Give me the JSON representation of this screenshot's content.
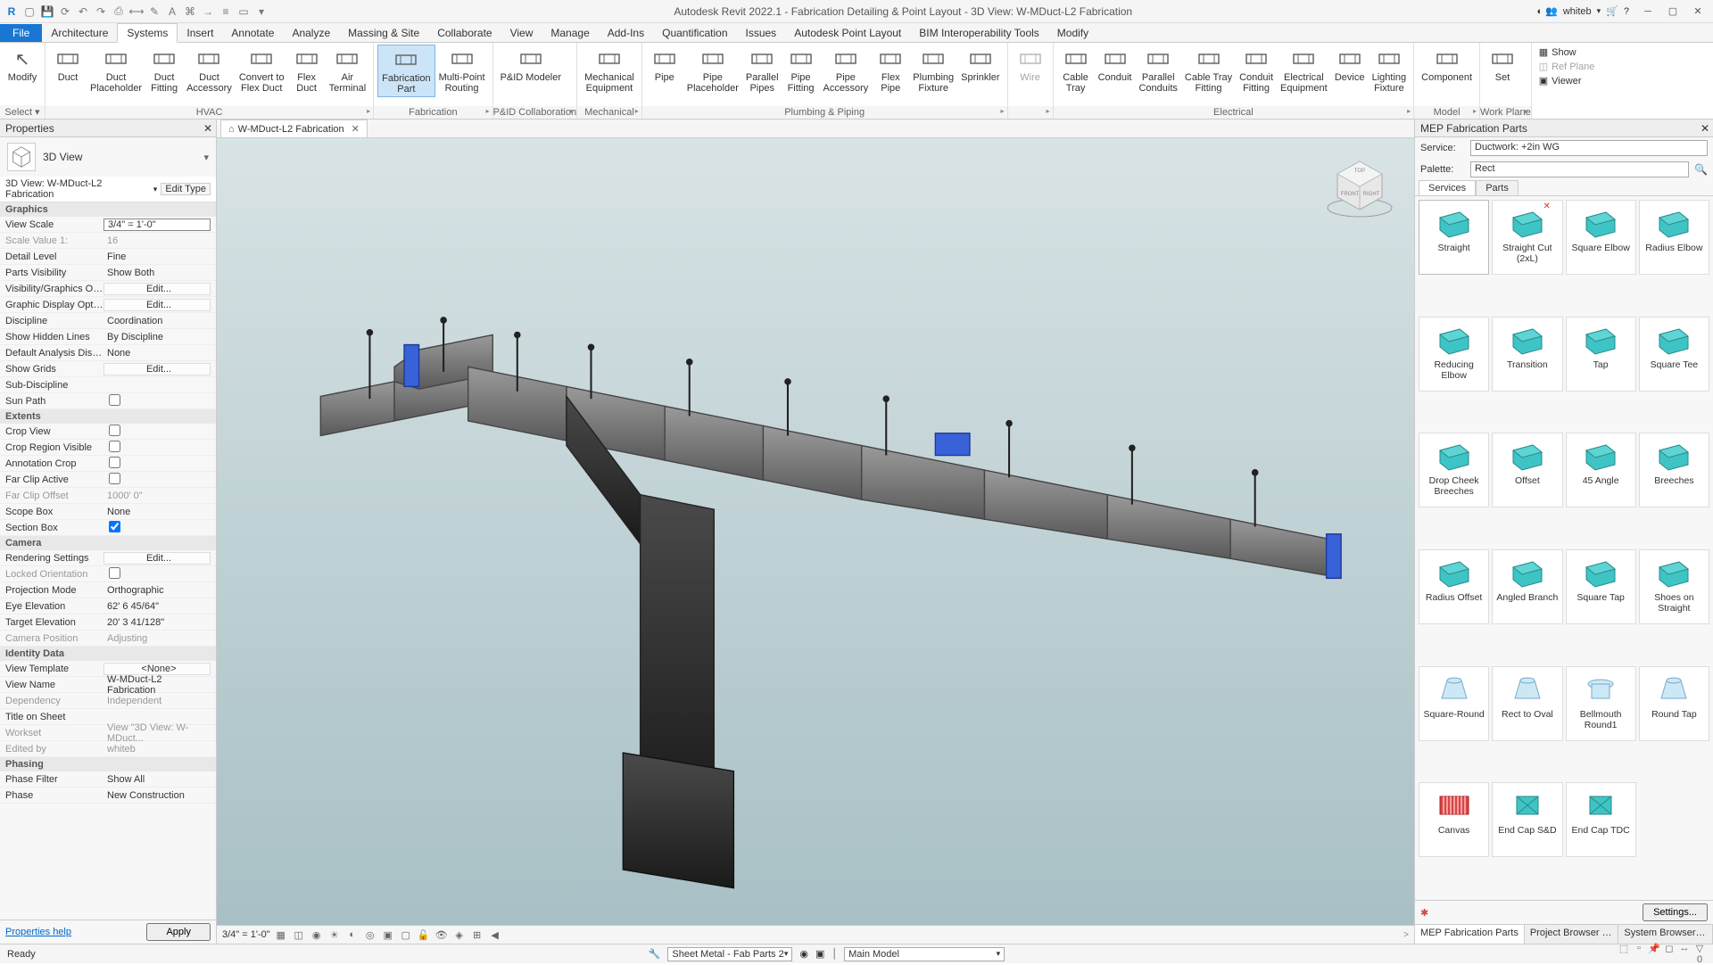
{
  "title": "Autodesk Revit 2022.1 - Fabrication Detailing & Point Layout - 3D View: W-MDuct-L2 Fabrication",
  "user": "whiteb",
  "menu_tabs": [
    "File",
    "Architecture",
    "Systems",
    "Insert",
    "Annotate",
    "Analyze",
    "Massing & Site",
    "Collaborate",
    "View",
    "Manage",
    "Add-Ins",
    "Quantification",
    "Issues",
    "Autodesk Point Layout",
    "BIM Interoperability Tools",
    "Modify"
  ],
  "active_menu": "Systems",
  "ribbon": {
    "select": "Select ▾",
    "groups": [
      {
        "label": "HVAC",
        "buttons": [
          {
            "label": "Duct",
            "icon": "duct"
          },
          {
            "label": "Duct\nPlaceholder",
            "icon": "duct-ph"
          },
          {
            "label": "Duct\nFitting",
            "icon": "duct-fit"
          },
          {
            "label": "Duct\nAccessory",
            "icon": "duct-acc"
          },
          {
            "label": "Convert to\nFlex Duct",
            "icon": "flex"
          },
          {
            "label": "Flex\nDuct",
            "icon": "flex-duct"
          },
          {
            "label": "Air\nTerminal",
            "icon": "air"
          }
        ]
      },
      {
        "label": "Fabrication",
        "buttons": [
          {
            "label": "Fabrication\nPart",
            "icon": "fab",
            "active": true
          },
          {
            "label": "Multi-Point\nRouting",
            "icon": "route"
          }
        ]
      },
      {
        "label": "P&ID Collaboration",
        "buttons": [
          {
            "label": "P&ID Modeler",
            "icon": "pid"
          }
        ]
      },
      {
        "label": "Mechanical",
        "buttons": [
          {
            "label": "Mechanical\nEquipment",
            "icon": "mech"
          }
        ]
      },
      {
        "label": "Plumbing & Piping",
        "buttons": [
          {
            "label": "Pipe",
            "icon": "pipe"
          },
          {
            "label": "Pipe\nPlaceholder",
            "icon": "pipe-ph"
          },
          {
            "label": "Parallel\nPipes",
            "icon": "parallel"
          },
          {
            "label": "Pipe\nFitting",
            "icon": "pipe-fit"
          },
          {
            "label": "Pipe\nAccessory",
            "icon": "pipe-acc"
          },
          {
            "label": "Flex\nPipe",
            "icon": "flex-pipe"
          },
          {
            "label": "Plumbing\nFixture",
            "icon": "plumb"
          },
          {
            "label": "Sprinkler",
            "icon": "sprinkler"
          }
        ]
      },
      {
        "label": "",
        "buttons": [
          {
            "label": "Wire",
            "icon": "wire",
            "disabled": true
          }
        ]
      },
      {
        "label": "Electrical",
        "buttons": [
          {
            "label": "Cable\nTray",
            "icon": "ctray"
          },
          {
            "label": "Conduit",
            "icon": "conduit"
          },
          {
            "label": "Parallel\nConduits",
            "icon": "pconduit"
          },
          {
            "label": "Cable Tray\nFitting",
            "icon": "ctfit"
          },
          {
            "label": "Conduit\nFitting",
            "icon": "cfit"
          },
          {
            "label": "Electrical\nEquipment",
            "icon": "eequip"
          },
          {
            "label": "Device",
            "icon": "device"
          },
          {
            "label": "Lighting\nFixture",
            "icon": "light"
          }
        ]
      },
      {
        "label": "Model",
        "buttons": [
          {
            "label": "Component",
            "icon": "comp"
          }
        ]
      },
      {
        "label": "Work Plane",
        "buttons": [
          {
            "label": "Set",
            "icon": "set"
          }
        ]
      }
    ],
    "workplane_items": [
      "Show",
      "Ref Plane",
      "Viewer"
    ]
  },
  "properties": {
    "title": "Properties",
    "type_name": "3D View",
    "instance_name": "3D View: W-MDuct-L2 Fabrication",
    "edit_type": "Edit Type",
    "sections": [
      {
        "name": "Graphics",
        "rows": [
          {
            "l": "View Scale",
            "v": "3/4\" = 1'-0\"",
            "boxed": true
          },
          {
            "l": "Scale Value    1:",
            "v": "16",
            "dim": true
          },
          {
            "l": "Detail Level",
            "v": "Fine"
          },
          {
            "l": "Parts Visibility",
            "v": "Show Both"
          },
          {
            "l": "Visibility/Graphics Overri...",
            "v": "Edit...",
            "btn": true
          },
          {
            "l": "Graphic Display Options",
            "v": "Edit...",
            "btn": true
          },
          {
            "l": "Discipline",
            "v": "Coordination"
          },
          {
            "l": "Show Hidden Lines",
            "v": "By Discipline"
          },
          {
            "l": "Default Analysis Display ...",
            "v": "None"
          },
          {
            "l": "Show Grids",
            "v": "Edit...",
            "btn": true
          },
          {
            "l": "Sub-Discipline",
            "v": ""
          },
          {
            "l": "Sun Path",
            "v": "",
            "check": false
          }
        ]
      },
      {
        "name": "Extents",
        "rows": [
          {
            "l": "Crop View",
            "v": "",
            "check": false
          },
          {
            "l": "Crop Region Visible",
            "v": "",
            "check": false
          },
          {
            "l": "Annotation Crop",
            "v": "",
            "check": false
          },
          {
            "l": "Far Clip Active",
            "v": "",
            "check": false
          },
          {
            "l": "Far Clip Offset",
            "v": "1000'  0\"",
            "dim": true
          },
          {
            "l": "Scope Box",
            "v": "None"
          },
          {
            "l": "Section Box",
            "v": "",
            "check": true
          }
        ]
      },
      {
        "name": "Camera",
        "rows": [
          {
            "l": "Rendering Settings",
            "v": "Edit...",
            "btn": true
          },
          {
            "l": "Locked Orientation",
            "v": "",
            "check": false,
            "dim": true
          },
          {
            "l": "Projection Mode",
            "v": "Orthographic"
          },
          {
            "l": "Eye Elevation",
            "v": "62'  6 45/64\""
          },
          {
            "l": "Target Elevation",
            "v": "20'  3 41/128\""
          },
          {
            "l": "Camera Position",
            "v": "Adjusting",
            "dim": true
          }
        ]
      },
      {
        "name": "Identity Data",
        "rows": [
          {
            "l": "View Template",
            "v": "<None>",
            "btn": true
          },
          {
            "l": "View Name",
            "v": "W-MDuct-L2 Fabrication"
          },
          {
            "l": "Dependency",
            "v": "Independent",
            "dim": true
          },
          {
            "l": "Title on Sheet",
            "v": ""
          },
          {
            "l": "Workset",
            "v": "View \"3D View: W-MDuct...",
            "dim": true
          },
          {
            "l": "Edited by",
            "v": "whiteb",
            "dim": true
          }
        ]
      },
      {
        "name": "Phasing",
        "rows": [
          {
            "l": "Phase Filter",
            "v": "Show All"
          },
          {
            "l": "Phase",
            "v": "New Construction"
          }
        ]
      }
    ],
    "help_link": "Properties help",
    "apply": "Apply"
  },
  "view_tab": "W-MDuct-L2 Fabrication",
  "canvas_scale": "3/4\" = 1'-0\"",
  "mep": {
    "title": "MEP Fabrication Parts",
    "service_label": "Service:",
    "service_value": "Ductwork: +2in WG",
    "palette_label": "Palette:",
    "palette_value": "Rect",
    "tabs": [
      "Services",
      "Parts"
    ],
    "active_tab": "Services",
    "items": [
      {
        "label": "Straight",
        "icon": "straight"
      },
      {
        "label": "Straight Cut (2xL)",
        "icon": "straightcut",
        "x": true
      },
      {
        "label": "Square Elbow",
        "icon": "sqelbow"
      },
      {
        "label": "Radius Elbow",
        "icon": "radelbow"
      },
      {
        "label": "Reducing Elbow",
        "icon": "redelbow"
      },
      {
        "label": "Transition",
        "icon": "transition"
      },
      {
        "label": "Tap",
        "icon": "tap"
      },
      {
        "label": "Square Tee",
        "icon": "sqtee"
      },
      {
        "label": "Drop Cheek Breeches",
        "icon": "dropcheek"
      },
      {
        "label": "Offset",
        "icon": "offset"
      },
      {
        "label": "45 Angle",
        "icon": "angle45"
      },
      {
        "label": "Breeches",
        "icon": "breeches"
      },
      {
        "label": "Radius Offset",
        "icon": "radoffset"
      },
      {
        "label": "Angled Branch",
        "icon": "angbranch"
      },
      {
        "label": "Square Tap",
        "icon": "sqtap"
      },
      {
        "label": "Shoes on Straight",
        "icon": "shoes"
      },
      {
        "label": "Square-Round",
        "icon": "sqround"
      },
      {
        "label": "Rect to Oval",
        "icon": "rectoval"
      },
      {
        "label": "Bellmouth Round1",
        "icon": "bellmouth"
      },
      {
        "label": "Round Tap",
        "icon": "roundtap"
      },
      {
        "label": "Canvas",
        "icon": "canvas"
      },
      {
        "label": "End Cap S&D",
        "icon": "endcap1"
      },
      {
        "label": "End Cap TDC",
        "icon": "endcap2"
      }
    ],
    "settings": "Settings...",
    "palette_tabs": [
      "MEP Fabrication Parts",
      "Project Browser - Fabric...",
      "System Browser - Fabric..."
    ]
  },
  "status": {
    "ready": "Ready",
    "sheet": "Sheet Metal - Fab Parts 2",
    "model": "Main Model"
  }
}
